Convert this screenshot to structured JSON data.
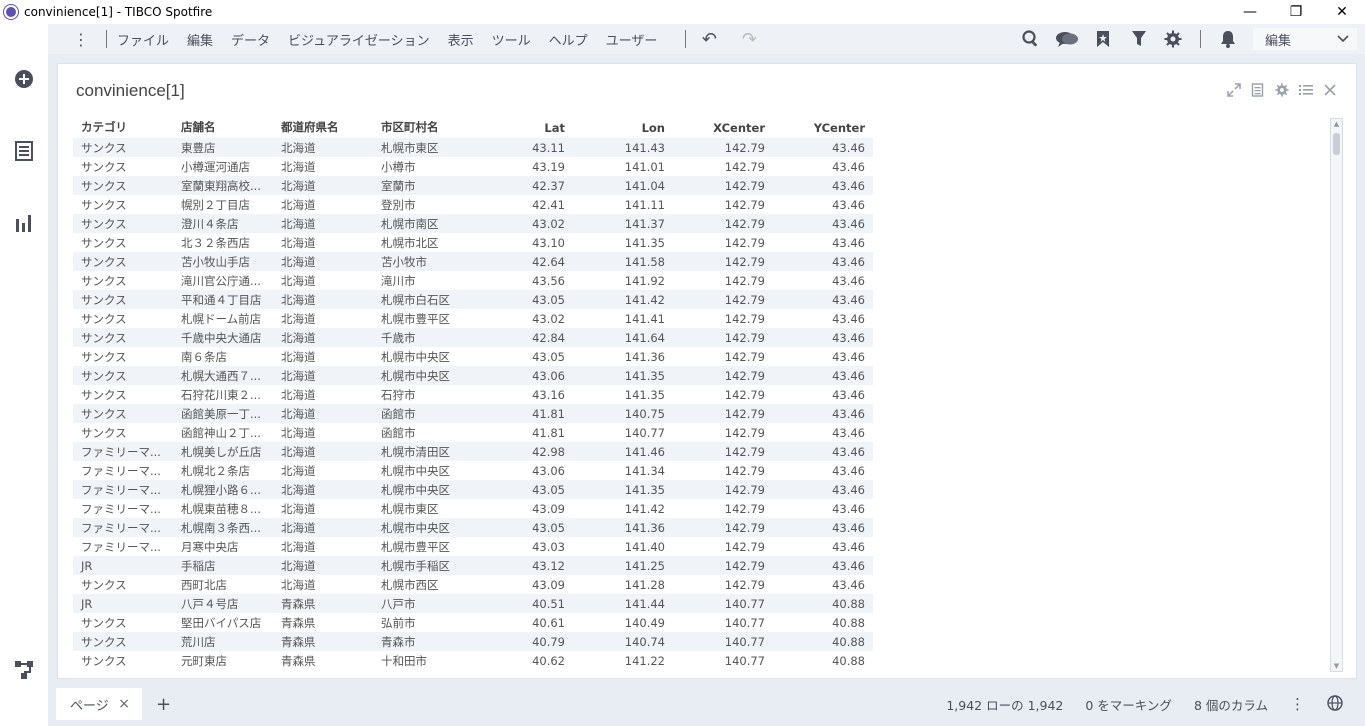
{
  "window": {
    "title": "convinience[1] - TIBCO Spotfire",
    "minimize": "—",
    "restore": "❐",
    "close": "✕"
  },
  "sidebar": {
    "items": [
      {
        "icon": "add-icon"
      },
      {
        "icon": "data-table-icon"
      },
      {
        "icon": "bar-chart-icon"
      },
      {
        "icon": "data-flow-icon"
      }
    ]
  },
  "menu": {
    "kebab": "⋮",
    "items": [
      "ファイル",
      "編集",
      "データ",
      "ビジュアライゼーション",
      "表示",
      "ツール",
      "ヘルプ",
      "ユーザー"
    ],
    "undo": "↶",
    "redo": "↷",
    "edit_mode": "編集"
  },
  "panel": {
    "title": "convinience[1]"
  },
  "table": {
    "headers": [
      "カテゴリ",
      "店舗名",
      "都道府県名",
      "市区町村名",
      "Lat",
      "Lon",
      "XCenter",
      "YCenter"
    ],
    "rows": [
      [
        "サンクス",
        "東豊店",
        "北海道",
        "札幌市東区",
        "43.11",
        "141.43",
        "142.79",
        "43.46"
      ],
      [
        "サンクス",
        "小樽運河通店",
        "北海道",
        "小樽市",
        "43.19",
        "141.01",
        "142.79",
        "43.46"
      ],
      [
        "サンクス",
        "室蘭東翔高校...",
        "北海道",
        "室蘭市",
        "42.37",
        "141.04",
        "142.79",
        "43.46"
      ],
      [
        "サンクス",
        "幌別２丁目店",
        "北海道",
        "登別市",
        "42.41",
        "141.11",
        "142.79",
        "43.46"
      ],
      [
        "サンクス",
        "澄川４条店",
        "北海道",
        "札幌市南区",
        "43.02",
        "141.37",
        "142.79",
        "43.46"
      ],
      [
        "サンクス",
        "北３２条西店",
        "北海道",
        "札幌市北区",
        "43.10",
        "141.35",
        "142.79",
        "43.46"
      ],
      [
        "サンクス",
        "苫小牧山手店",
        "北海道",
        "苫小牧市",
        "42.64",
        "141.58",
        "142.79",
        "43.46"
      ],
      [
        "サンクス",
        "滝川官公庁通...",
        "北海道",
        "滝川市",
        "43.56",
        "141.92",
        "142.79",
        "43.46"
      ],
      [
        "サンクス",
        "平和通４丁目店",
        "北海道",
        "札幌市白石区",
        "43.05",
        "141.42",
        "142.79",
        "43.46"
      ],
      [
        "サンクス",
        "札幌ドーム前店",
        "北海道",
        "札幌市豊平区",
        "43.02",
        "141.41",
        "142.79",
        "43.46"
      ],
      [
        "サンクス",
        "千歳中央大通店",
        "北海道",
        "千歳市",
        "42.84",
        "141.64",
        "142.79",
        "43.46"
      ],
      [
        "サンクス",
        "南６条店",
        "北海道",
        "札幌市中央区",
        "43.05",
        "141.36",
        "142.79",
        "43.46"
      ],
      [
        "サンクス",
        "札幌大通西７...",
        "北海道",
        "札幌市中央区",
        "43.06",
        "141.35",
        "142.79",
        "43.46"
      ],
      [
        "サンクス",
        "石狩花川東２...",
        "北海道",
        "石狩市",
        "43.16",
        "141.35",
        "142.79",
        "43.46"
      ],
      [
        "サンクス",
        "函館美原一丁...",
        "北海道",
        "函館市",
        "41.81",
        "140.75",
        "142.79",
        "43.46"
      ],
      [
        "サンクス",
        "函館神山２丁...",
        "北海道",
        "函館市",
        "41.81",
        "140.77",
        "142.79",
        "43.46"
      ],
      [
        "ファミリーマ...",
        "札幌美しが丘店",
        "北海道",
        "札幌市清田区",
        "42.98",
        "141.46",
        "142.79",
        "43.46"
      ],
      [
        "ファミリーマ...",
        "札幌北２条店",
        "北海道",
        "札幌市中央区",
        "43.06",
        "141.34",
        "142.79",
        "43.46"
      ],
      [
        "ファミリーマ...",
        "札幌狸小路６...",
        "北海道",
        "札幌市中央区",
        "43.05",
        "141.35",
        "142.79",
        "43.46"
      ],
      [
        "ファミリーマ...",
        "札幌東苗穂８...",
        "北海道",
        "札幌市東区",
        "43.09",
        "141.42",
        "142.79",
        "43.46"
      ],
      [
        "ファミリーマ...",
        "札幌南３条西...",
        "北海道",
        "札幌市中央区",
        "43.05",
        "141.36",
        "142.79",
        "43.46"
      ],
      [
        "ファミリーマ...",
        "月寒中央店",
        "北海道",
        "札幌市豊平区",
        "43.03",
        "141.40",
        "142.79",
        "43.46"
      ],
      [
        "JR",
        "手稲店",
        "北海道",
        "札幌市手稲区",
        "43.12",
        "141.25",
        "142.79",
        "43.46"
      ],
      [
        "サンクス",
        "西町北店",
        "北海道",
        "札幌市西区",
        "43.09",
        "141.28",
        "142.79",
        "43.46"
      ],
      [
        "JR",
        "八戸４号店",
        "青森県",
        "八戸市",
        "40.51",
        "141.44",
        "140.77",
        "40.88"
      ],
      [
        "サンクス",
        "堅田バイパス店",
        "青森県",
        "弘前市",
        "40.61",
        "140.49",
        "140.77",
        "40.88"
      ],
      [
        "サンクス",
        "荒川店",
        "青森県",
        "青森市",
        "40.79",
        "140.74",
        "140.77",
        "40.88"
      ],
      [
        "サンクス",
        "元町東店",
        "青森県",
        "十和田市",
        "40.62",
        "141.22",
        "140.77",
        "40.88"
      ]
    ]
  },
  "statusbar": {
    "page_tab": "ページ",
    "close_tab": "×",
    "add_page": "+",
    "rows_info": "1,942 ローの 1,942",
    "marking_info": "0 をマーキング",
    "columns_info": "8 個のカラム",
    "more": "⋮"
  },
  "colors": {
    "accent": "#5b4fb3",
    "stripe": "#f0f3f8",
    "toolbar_bg": "#eef1f6"
  }
}
